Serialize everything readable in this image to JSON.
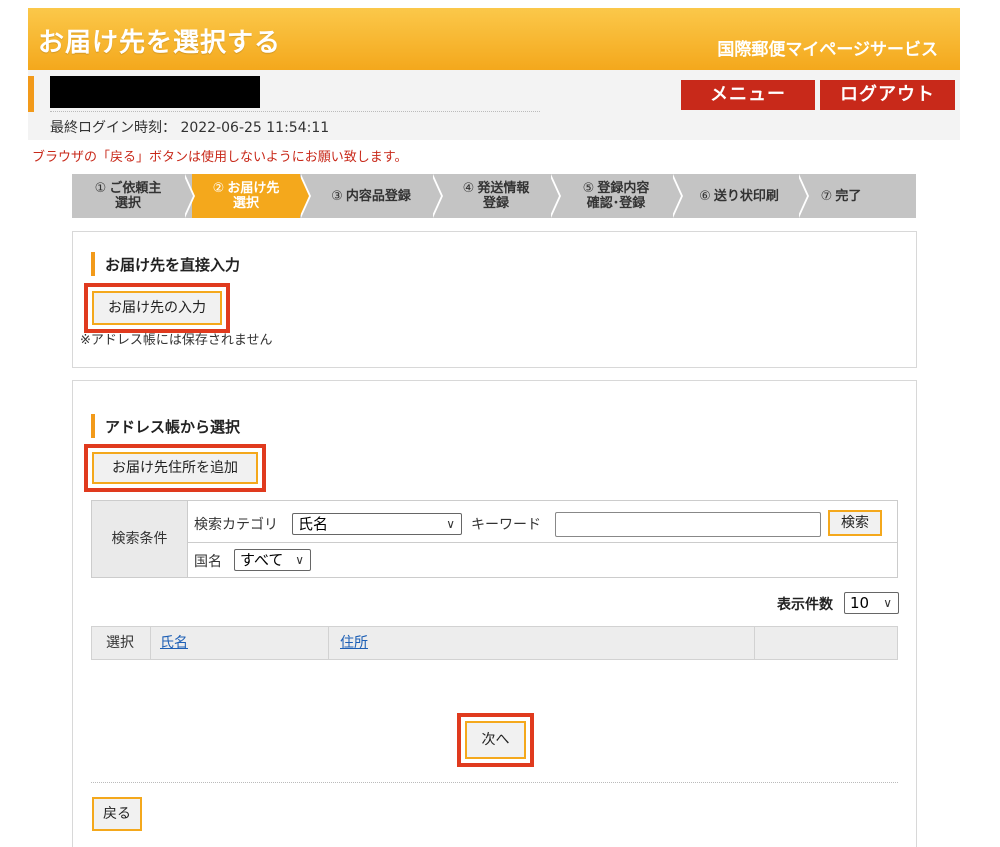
{
  "header": {
    "title": "お届け先を選択する",
    "service_name": "国際郵便マイページサービス"
  },
  "user": {
    "last_login_label": "最終ログイン時刻：",
    "last_login_time": "2022-06-25 11:54:11"
  },
  "nav": {
    "menu_label": "メニュー",
    "logout_label": "ログアウト"
  },
  "warning": "ブラウザの「戻る」ボタンは使用しないようにお願い致します。",
  "steps": [
    {
      "num": "①",
      "line1": "ご依頼主",
      "line2": "選択",
      "active": false
    },
    {
      "num": "②",
      "line1": "お届け先",
      "line2": "選択",
      "active": true
    },
    {
      "num": "③",
      "line1": "内容品登録",
      "line2": "",
      "active": false
    },
    {
      "num": "④",
      "line1": "発送情報",
      "line2": "登録",
      "active": false
    },
    {
      "num": "⑤",
      "line1": "登録内容",
      "line2": "確認･登録",
      "active": false
    },
    {
      "num": "⑥",
      "line1": "送り状印刷",
      "line2": "",
      "active": false
    },
    {
      "num": "⑦",
      "line1": "完了",
      "line2": "",
      "active": false
    }
  ],
  "direct_input": {
    "title": "お届け先を直接入力",
    "button_label": "お届け先の入力",
    "note": "※アドレス帳には保存されません"
  },
  "address_book": {
    "title": "アドレス帳から選択",
    "add_button_label": "お届け先住所を追加",
    "search": {
      "conditions_label": "検索条件",
      "category_label": "検索カテゴリ",
      "category_value": "氏名",
      "keyword_label": "キーワード",
      "keyword_value": "",
      "search_button": "検索",
      "country_label": "国名",
      "country_value": "すべて"
    },
    "page_size_label": "表示件数",
    "page_size_value": "10",
    "table": {
      "columns": [
        "選択",
        "氏名",
        "住所",
        ""
      ]
    },
    "next_button": "次へ",
    "back_button": "戻る"
  },
  "colors": {
    "header_orange": "#f4a81c",
    "accent_red": "#c8291a",
    "highlight_frame": "#e03a1e",
    "link_blue": "#1d5fb5"
  }
}
